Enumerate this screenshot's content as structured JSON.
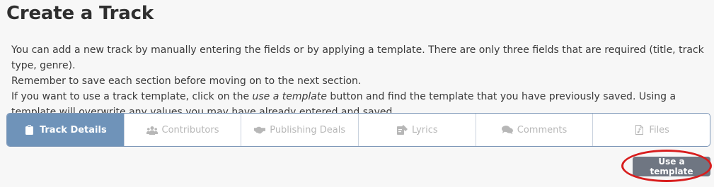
{
  "page": {
    "title": "Create a Track"
  },
  "intro": {
    "line1": "You can add a new track by manually entering the fields or by applying a template. There are only three fields that are required (title, track type, genre).",
    "line2": "Remember to save each section before moving on to the next section.",
    "line3_before": "If you want to use a track template, click on the ",
    "line3_emph": "use a template",
    "line3_after": " button and find the template that you have previously saved. Using a template will overwrite any values you may have already entered and saved."
  },
  "tabs": [
    {
      "label": "Track Details",
      "icon": "clipboard-icon",
      "active": true
    },
    {
      "label": "Contributors",
      "icon": "users-icon",
      "active": false
    },
    {
      "label": "Publishing Deals",
      "icon": "handshake-icon",
      "active": false
    },
    {
      "label": "Lyrics",
      "icon": "lyrics-icon",
      "active": false
    },
    {
      "label": "Comments",
      "icon": "comments-icon",
      "active": false
    },
    {
      "label": "Files",
      "icon": "music-file-icon",
      "active": false
    }
  ],
  "actions": {
    "use_template_label": "Use a template"
  },
  "colors": {
    "active_tab": "#6f93b9",
    "tab_border": "#7d97b8",
    "button": "#6f7682",
    "highlight_ring": "#d81e1e"
  }
}
